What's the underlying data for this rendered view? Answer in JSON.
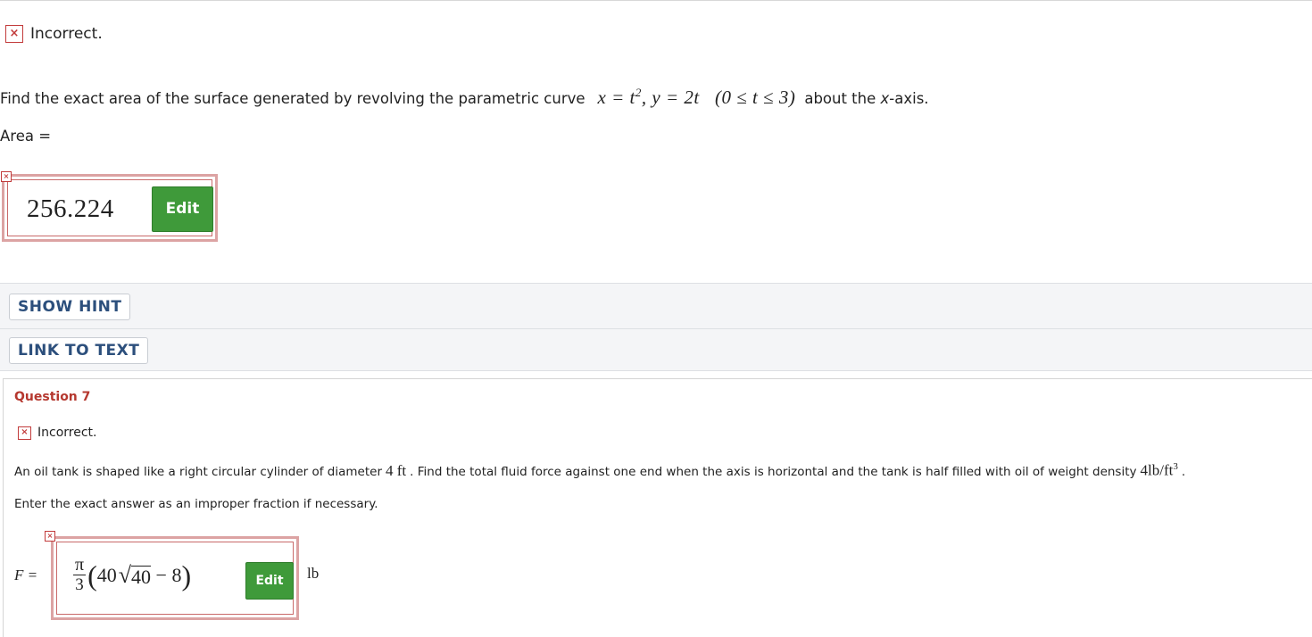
{
  "question6": {
    "status": {
      "icon": "x-icon",
      "glyph": "×",
      "text": "Incorrect."
    },
    "prompt_before": "Find the exact area of the surface generated by revolving the parametric curve",
    "math": {
      "x_eq": "x = t",
      "x_exp": "2",
      "y_eq": ",   y = 2t",
      "range": "(0 ≤ t ≤ 3)"
    },
    "prompt_after_1": "about the ",
    "prompt_axis": "x",
    "prompt_after_2": "-axis.",
    "area_label": "Area =",
    "answer_value": "256.224",
    "edit_label": "Edit",
    "marker_glyph": "×"
  },
  "buttons": {
    "show_hint": "SHOW HINT",
    "link_to_text": "LINK TO TEXT"
  },
  "question7": {
    "title": "Question 7",
    "status": {
      "icon": "x-icon",
      "glyph": "×",
      "text": "Incorrect."
    },
    "prompt_part1": "An oil tank is shaped like a right circular cylinder of diameter",
    "diameter": "4 ft",
    "prompt_part2": ". Find the total fluid force against one end when the axis is horizontal and the tank is half filled with oil of weight density",
    "density": "4lb/ft",
    "density_exp": "3",
    "prompt_end": ".",
    "instruction": "Enter the exact answer as an improper fraction if necessary.",
    "f_label": "F =",
    "answer": {
      "numerator": "π",
      "denominator": "3",
      "open_paren": "(",
      "coef": "40",
      "radical": "√",
      "radicand": "40",
      "rest": " − 8",
      "close_paren": ")"
    },
    "edit_label": "Edit",
    "unit": "lb",
    "marker_glyph": "×"
  },
  "colors": {
    "error_red": "#c23b3b",
    "title_red": "#b5382f",
    "edit_green": "#3f9a3a",
    "link_blue": "#2c4f7c"
  }
}
